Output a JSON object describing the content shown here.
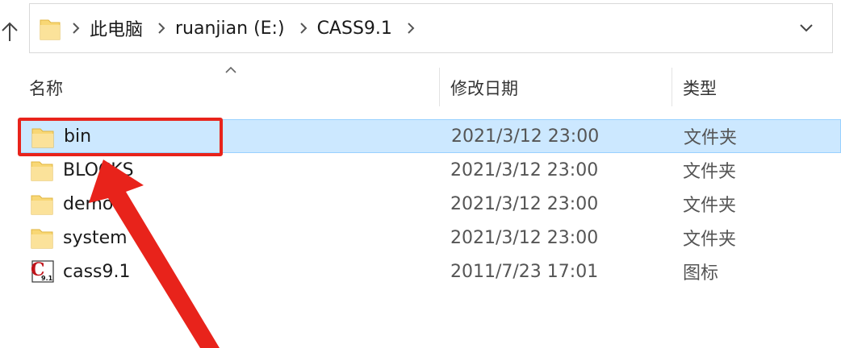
{
  "address_bar": {
    "breadcrumbs": [
      "此电脑",
      "ruanjian (E:)",
      "CASS9.1"
    ]
  },
  "columns": {
    "name": "名称",
    "date_modified": "修改日期",
    "type": "类型"
  },
  "files": [
    {
      "name": "bin",
      "date": "2021/3/12 23:00",
      "type": "文件夹",
      "icon": "folder-icon",
      "selected": true
    },
    {
      "name": "BLOCKS",
      "date": "2021/3/12 23:00",
      "type": "文件夹",
      "icon": "folder-icon",
      "selected": false
    },
    {
      "name": "demo",
      "date": "2021/3/12 23:00",
      "type": "文件夹",
      "icon": "folder-icon",
      "selected": false
    },
    {
      "name": "system",
      "date": "2021/3/12 23:00",
      "type": "文件夹",
      "icon": "folder-icon",
      "selected": false
    },
    {
      "name": "cass9.1",
      "date": "2011/7/23 17:01",
      "type": "图标",
      "icon": "cass-app-icon",
      "selected": false
    }
  ],
  "colors": {
    "selection_bg": "#cce8ff",
    "selection_border": "#99d1ff",
    "folder_yellow": "#f8d775",
    "annotation_red": "#e8231b"
  }
}
